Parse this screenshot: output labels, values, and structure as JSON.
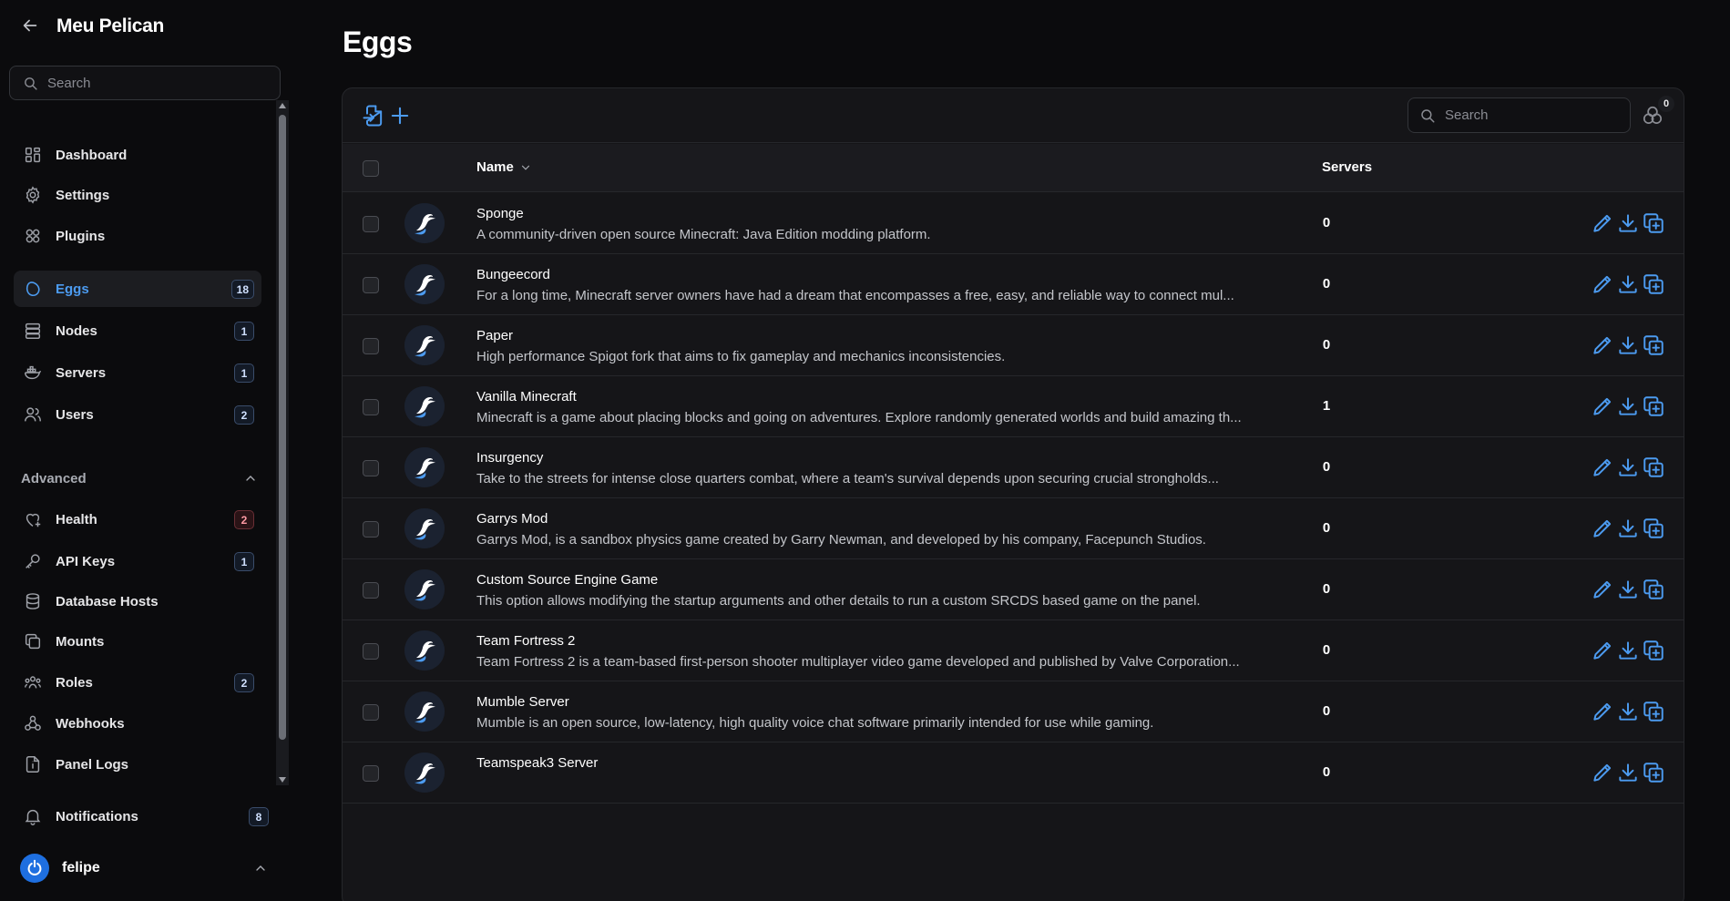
{
  "app": {
    "title": "Meu Pelican"
  },
  "sidebar": {
    "search_placeholder": "Search",
    "items": [
      {
        "label": "Dashboard",
        "icon": "dashboard-icon"
      },
      {
        "label": "Settings",
        "icon": "gear-icon"
      },
      {
        "label": "Plugins",
        "icon": "puzzle-icon"
      },
      {
        "label": "Eggs",
        "icon": "egg-icon",
        "badge": "18",
        "active": true
      },
      {
        "label": "Nodes",
        "icon": "server-stack-icon",
        "badge": "1"
      },
      {
        "label": "Servers",
        "icon": "brand-docker-icon",
        "badge": "1"
      },
      {
        "label": "Users",
        "icon": "users-icon",
        "badge": "2"
      }
    ],
    "advanced_label": "Advanced",
    "advanced_items": [
      {
        "label": "Health",
        "icon": "heart-icon",
        "badge": "2",
        "badge_style": "danger"
      },
      {
        "label": "API Keys",
        "icon": "key-icon",
        "badge": "1"
      },
      {
        "label": "Database Hosts",
        "icon": "database-icon"
      },
      {
        "label": "Mounts",
        "icon": "layers-icon"
      },
      {
        "label": "Roles",
        "icon": "user-group-icon",
        "badge": "2"
      },
      {
        "label": "Webhooks",
        "icon": "webhook-icon"
      },
      {
        "label": "Panel Logs",
        "icon": "file-info-icon"
      }
    ],
    "notifications": {
      "label": "Notifications",
      "badge": "8"
    },
    "user": {
      "name": "felipe"
    }
  },
  "page": {
    "title": "Eggs"
  },
  "toolbar": {
    "search_placeholder": "Search",
    "filter_count": "0"
  },
  "table": {
    "columns": {
      "name": "Name",
      "servers": "Servers"
    },
    "rows": [
      {
        "name": "Sponge",
        "description": "A community-driven open source Minecraft: Java Edition modding platform.",
        "servers": "0"
      },
      {
        "name": "Bungeecord",
        "description": "For a long time, Minecraft server owners have had a dream that encompasses a free, easy, and reliable way to connect mul...",
        "servers": "0"
      },
      {
        "name": "Paper",
        "description": "High performance Spigot fork that aims to fix gameplay and mechanics inconsistencies.",
        "servers": "0"
      },
      {
        "name": "Vanilla Minecraft",
        "description": "Minecraft is a game about placing blocks and going on adventures. Explore randomly generated worlds and build amazing th...",
        "servers": "1"
      },
      {
        "name": "Insurgency",
        "description": "Take to the streets for intense close quarters combat, where a team's survival depends upon securing crucial strongholds...",
        "servers": "0"
      },
      {
        "name": "Garrys Mod",
        "description": "Garrys Mod, is a sandbox physics game created by Garry Newman, and developed by his company, Facepunch Studios.",
        "servers": "0"
      },
      {
        "name": "Custom Source Engine Game",
        "description": "This option allows modifying the startup arguments and other details to run a custom SRCDS based game on the panel.",
        "servers": "0"
      },
      {
        "name": "Team Fortress 2",
        "description": "Team Fortress 2 is a team-based first-person shooter multiplayer video game developed and published by Valve Corporation...",
        "servers": "0"
      },
      {
        "name": "Mumble Server",
        "description": "Mumble is an open source, low-latency, high quality voice chat software primarily intended for use while gaming.",
        "servers": "0"
      },
      {
        "name": "Teamspeak3 Server",
        "description": "",
        "servers": "0"
      }
    ]
  },
  "colors": {
    "accent": "#4c9bf0",
    "background": "#0b0b0d",
    "panel": "#151518",
    "danger": "#ff9aa4"
  }
}
